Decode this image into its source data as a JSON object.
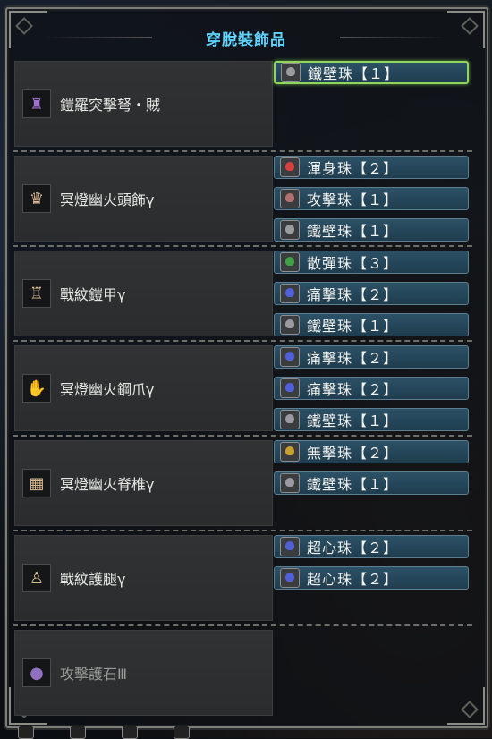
{
  "title": "穿脫裝飾品",
  "rows": [
    {
      "equipment": "鎧羅突擊弩・賊",
      "icon": "weapon-icon",
      "decorations": [
        {
          "label": "鐵壁珠【１】",
          "gem_color": "#9a9aa0",
          "selected": true
        }
      ]
    },
    {
      "equipment": "冥燈幽火頭飾γ",
      "icon": "helmet-icon",
      "decorations": [
        {
          "label": "渾身珠【２】",
          "gem_color": "#d64040",
          "selected": false
        },
        {
          "label": "攻擊珠【１】",
          "gem_color": "#b07070",
          "selected": false
        },
        {
          "label": "鐵壁珠【１】",
          "gem_color": "#9a9aa0",
          "selected": false
        }
      ]
    },
    {
      "equipment": "戰紋鎧甲γ",
      "icon": "chest-armor-icon",
      "decorations": [
        {
          "label": "散彈珠【３】",
          "gem_color": "#3fa046",
          "selected": false
        },
        {
          "label": "痛擊珠【２】",
          "gem_color": "#5060d8",
          "selected": false
        },
        {
          "label": "鐵壁珠【１】",
          "gem_color": "#9a9aa0",
          "selected": false
        }
      ]
    },
    {
      "equipment": "冥燈幽火鋼爪γ",
      "icon": "gauntlet-icon",
      "decorations": [
        {
          "label": "痛擊珠【２】",
          "gem_color": "#5060d8",
          "selected": false
        },
        {
          "label": "痛擊珠【２】",
          "gem_color": "#5060d8",
          "selected": false
        },
        {
          "label": "鐵壁珠【１】",
          "gem_color": "#9a9aa0",
          "selected": false
        }
      ]
    },
    {
      "equipment": "冥燈幽火脊椎γ",
      "icon": "waist-armor-icon",
      "decorations": [
        {
          "label": "無擊珠【２】",
          "gem_color": "#c8a030",
          "selected": false
        },
        {
          "label": "鐵壁珠【１】",
          "gem_color": "#9a9aa0",
          "selected": false
        }
      ]
    },
    {
      "equipment": "戰紋護腿γ",
      "icon": "leg-armor-icon",
      "decorations": [
        {
          "label": "超心珠【２】",
          "gem_color": "#5060d8",
          "selected": false
        },
        {
          "label": "超心珠【２】",
          "gem_color": "#5060d8",
          "selected": false
        }
      ]
    },
    {
      "equipment": "攻擊護石Ⅲ",
      "icon": "charm-icon",
      "dim": true,
      "decorations": []
    }
  ],
  "icon_glyphs": {
    "weapon-icon": "♜",
    "helmet-icon": "♛",
    "chest-armor-icon": "♖",
    "gauntlet-icon": "✋",
    "waist-armor-icon": "▦",
    "leg-armor-icon": "♙",
    "charm-icon": "●"
  },
  "icon_colors": {
    "weapon-icon": "#a070d0",
    "helmet-icon": "#d8b890",
    "chest-armor-icon": "#d8b890",
    "gauntlet-icon": "#d8b890",
    "waist-armor-icon": "#d8b890",
    "leg-armor-icon": "#d8b890",
    "charm-icon": "#9070c0"
  }
}
